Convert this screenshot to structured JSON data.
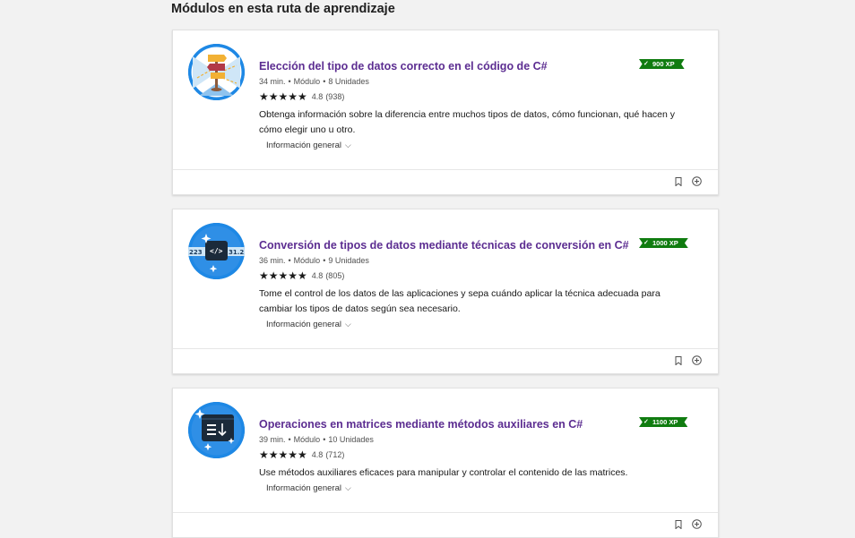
{
  "section": {
    "title": "Módulos en esta ruta de aprendizaje"
  },
  "modules": [
    {
      "title": "Elección del tipo de datos correcto en el código de C#",
      "duration": "34 min.",
      "type": "Módulo",
      "units": "8 Unidades",
      "rating": "4.8",
      "rating_count": "(938)",
      "stars": "★★★★★",
      "description": "Obtenga información sobre la diferencia entre muchos tipos de datos, cómo funcionan, qué hacen y cómo elegir uno u otro.",
      "overview": "Información general",
      "xp": "900 XP"
    },
    {
      "title": "Conversión de tipos de datos mediante técnicas de conversión en C#",
      "duration": "36 min.",
      "type": "Módulo",
      "units": "9 Unidades",
      "rating": "4.8",
      "rating_count": "(805)",
      "stars": "★★★★★",
      "description": "Tome el control de los datos de las aplicaciones y sepa cuándo aplicar la técnica adecuada para cambiar los tipos de datos según sea necesario.",
      "overview": "Información general",
      "xp": "1000 XP",
      "icon_text_left": "223",
      "icon_text_right": "31.2"
    },
    {
      "title": "Operaciones en matrices mediante métodos auxiliares en C#",
      "duration": "39 min.",
      "type": "Módulo",
      "units": "10 Unidades",
      "rating": "4.8",
      "rating_count": "(712)",
      "stars": "★★★★★",
      "description": "Use métodos auxiliares eficaces para manipular y controlar el contenido de las matrices.",
      "overview": "Información general",
      "xp": "1100 XP"
    }
  ],
  "colors": {
    "title": "#5c2d91",
    "xp_badge": "#107c10",
    "icon_ring": "#0078d4",
    "background": "#f2f2f2"
  },
  "icons": {
    "bookmark": "bookmark-icon",
    "add": "add-circle-icon",
    "chevron": "chevron-down-icon",
    "check": "check-icon"
  }
}
